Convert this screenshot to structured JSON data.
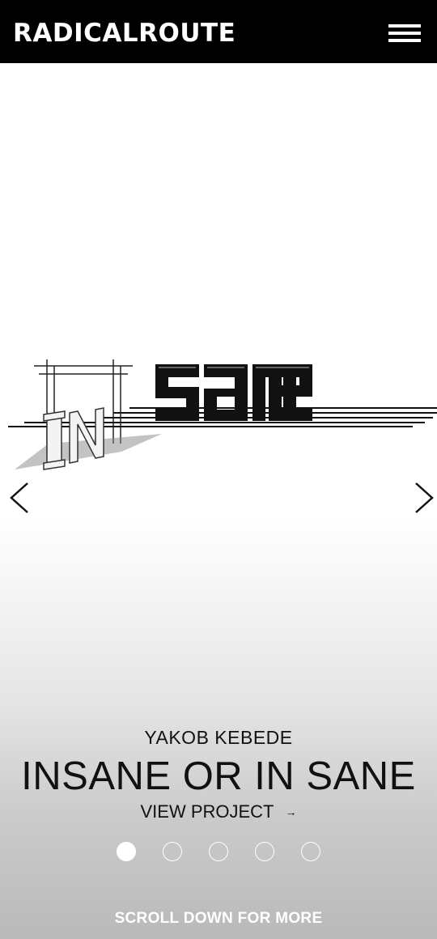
{
  "header": {
    "brand": "RADICALROUTE",
    "menu_icon": "hamburger-menu-icon"
  },
  "slide": {
    "author": "YAKOB KEBEDE",
    "title": "INSANE OR IN SANE",
    "view_label": "VIEW PROJECT",
    "view_arrow": "→",
    "artwork": {
      "in_text": "IN",
      "sane_text": "sane"
    }
  },
  "carousel": {
    "prev_icon": "chevron-left-icon",
    "next_icon": "chevron-right-icon",
    "slide_count": 5,
    "active_index": 0
  },
  "footer": {
    "scroll_label": "SCROLL DOWN FOR MORE"
  },
  "colors": {
    "header_bg": "#000000",
    "text": "#111111",
    "light": "#ffffff"
  }
}
